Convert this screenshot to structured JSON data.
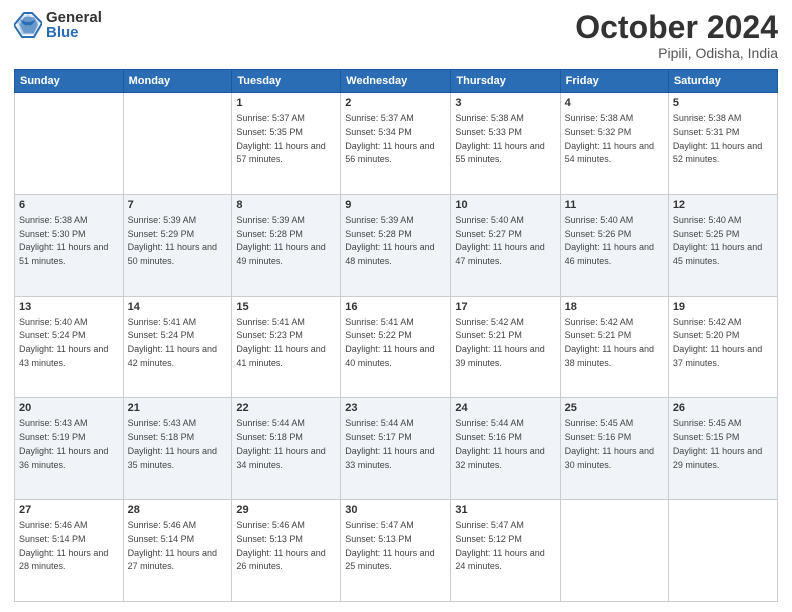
{
  "header": {
    "logo_general": "General",
    "logo_blue": "Blue",
    "month": "October 2024",
    "location": "Pipili, Odisha, India"
  },
  "weekdays": [
    "Sunday",
    "Monday",
    "Tuesday",
    "Wednesday",
    "Thursday",
    "Friday",
    "Saturday"
  ],
  "weeks": [
    [
      {
        "day": "",
        "sunrise": "",
        "sunset": "",
        "daylight": ""
      },
      {
        "day": "",
        "sunrise": "",
        "sunset": "",
        "daylight": ""
      },
      {
        "day": "1",
        "sunrise": "Sunrise: 5:37 AM",
        "sunset": "Sunset: 5:35 PM",
        "daylight": "Daylight: 11 hours and 57 minutes."
      },
      {
        "day": "2",
        "sunrise": "Sunrise: 5:37 AM",
        "sunset": "Sunset: 5:34 PM",
        "daylight": "Daylight: 11 hours and 56 minutes."
      },
      {
        "day": "3",
        "sunrise": "Sunrise: 5:38 AM",
        "sunset": "Sunset: 5:33 PM",
        "daylight": "Daylight: 11 hours and 55 minutes."
      },
      {
        "day": "4",
        "sunrise": "Sunrise: 5:38 AM",
        "sunset": "Sunset: 5:32 PM",
        "daylight": "Daylight: 11 hours and 54 minutes."
      },
      {
        "day": "5",
        "sunrise": "Sunrise: 5:38 AM",
        "sunset": "Sunset: 5:31 PM",
        "daylight": "Daylight: 11 hours and 52 minutes."
      }
    ],
    [
      {
        "day": "6",
        "sunrise": "Sunrise: 5:38 AM",
        "sunset": "Sunset: 5:30 PM",
        "daylight": "Daylight: 11 hours and 51 minutes."
      },
      {
        "day": "7",
        "sunrise": "Sunrise: 5:39 AM",
        "sunset": "Sunset: 5:29 PM",
        "daylight": "Daylight: 11 hours and 50 minutes."
      },
      {
        "day": "8",
        "sunrise": "Sunrise: 5:39 AM",
        "sunset": "Sunset: 5:28 PM",
        "daylight": "Daylight: 11 hours and 49 minutes."
      },
      {
        "day": "9",
        "sunrise": "Sunrise: 5:39 AM",
        "sunset": "Sunset: 5:28 PM",
        "daylight": "Daylight: 11 hours and 48 minutes."
      },
      {
        "day": "10",
        "sunrise": "Sunrise: 5:40 AM",
        "sunset": "Sunset: 5:27 PM",
        "daylight": "Daylight: 11 hours and 47 minutes."
      },
      {
        "day": "11",
        "sunrise": "Sunrise: 5:40 AM",
        "sunset": "Sunset: 5:26 PM",
        "daylight": "Daylight: 11 hours and 46 minutes."
      },
      {
        "day": "12",
        "sunrise": "Sunrise: 5:40 AM",
        "sunset": "Sunset: 5:25 PM",
        "daylight": "Daylight: 11 hours and 45 minutes."
      }
    ],
    [
      {
        "day": "13",
        "sunrise": "Sunrise: 5:40 AM",
        "sunset": "Sunset: 5:24 PM",
        "daylight": "Daylight: 11 hours and 43 minutes."
      },
      {
        "day": "14",
        "sunrise": "Sunrise: 5:41 AM",
        "sunset": "Sunset: 5:24 PM",
        "daylight": "Daylight: 11 hours and 42 minutes."
      },
      {
        "day": "15",
        "sunrise": "Sunrise: 5:41 AM",
        "sunset": "Sunset: 5:23 PM",
        "daylight": "Daylight: 11 hours and 41 minutes."
      },
      {
        "day": "16",
        "sunrise": "Sunrise: 5:41 AM",
        "sunset": "Sunset: 5:22 PM",
        "daylight": "Daylight: 11 hours and 40 minutes."
      },
      {
        "day": "17",
        "sunrise": "Sunrise: 5:42 AM",
        "sunset": "Sunset: 5:21 PM",
        "daylight": "Daylight: 11 hours and 39 minutes."
      },
      {
        "day": "18",
        "sunrise": "Sunrise: 5:42 AM",
        "sunset": "Sunset: 5:21 PM",
        "daylight": "Daylight: 11 hours and 38 minutes."
      },
      {
        "day": "19",
        "sunrise": "Sunrise: 5:42 AM",
        "sunset": "Sunset: 5:20 PM",
        "daylight": "Daylight: 11 hours and 37 minutes."
      }
    ],
    [
      {
        "day": "20",
        "sunrise": "Sunrise: 5:43 AM",
        "sunset": "Sunset: 5:19 PM",
        "daylight": "Daylight: 11 hours and 36 minutes."
      },
      {
        "day": "21",
        "sunrise": "Sunrise: 5:43 AM",
        "sunset": "Sunset: 5:18 PM",
        "daylight": "Daylight: 11 hours and 35 minutes."
      },
      {
        "day": "22",
        "sunrise": "Sunrise: 5:44 AM",
        "sunset": "Sunset: 5:18 PM",
        "daylight": "Daylight: 11 hours and 34 minutes."
      },
      {
        "day": "23",
        "sunrise": "Sunrise: 5:44 AM",
        "sunset": "Sunset: 5:17 PM",
        "daylight": "Daylight: 11 hours and 33 minutes."
      },
      {
        "day": "24",
        "sunrise": "Sunrise: 5:44 AM",
        "sunset": "Sunset: 5:16 PM",
        "daylight": "Daylight: 11 hours and 32 minutes."
      },
      {
        "day": "25",
        "sunrise": "Sunrise: 5:45 AM",
        "sunset": "Sunset: 5:16 PM",
        "daylight": "Daylight: 11 hours and 30 minutes."
      },
      {
        "day": "26",
        "sunrise": "Sunrise: 5:45 AM",
        "sunset": "Sunset: 5:15 PM",
        "daylight": "Daylight: 11 hours and 29 minutes."
      }
    ],
    [
      {
        "day": "27",
        "sunrise": "Sunrise: 5:46 AM",
        "sunset": "Sunset: 5:14 PM",
        "daylight": "Daylight: 11 hours and 28 minutes."
      },
      {
        "day": "28",
        "sunrise": "Sunrise: 5:46 AM",
        "sunset": "Sunset: 5:14 PM",
        "daylight": "Daylight: 11 hours and 27 minutes."
      },
      {
        "day": "29",
        "sunrise": "Sunrise: 5:46 AM",
        "sunset": "Sunset: 5:13 PM",
        "daylight": "Daylight: 11 hours and 26 minutes."
      },
      {
        "day": "30",
        "sunrise": "Sunrise: 5:47 AM",
        "sunset": "Sunset: 5:13 PM",
        "daylight": "Daylight: 11 hours and 25 minutes."
      },
      {
        "day": "31",
        "sunrise": "Sunrise: 5:47 AM",
        "sunset": "Sunset: 5:12 PM",
        "daylight": "Daylight: 11 hours and 24 minutes."
      },
      {
        "day": "",
        "sunrise": "",
        "sunset": "",
        "daylight": ""
      },
      {
        "day": "",
        "sunrise": "",
        "sunset": "",
        "daylight": ""
      }
    ]
  ]
}
